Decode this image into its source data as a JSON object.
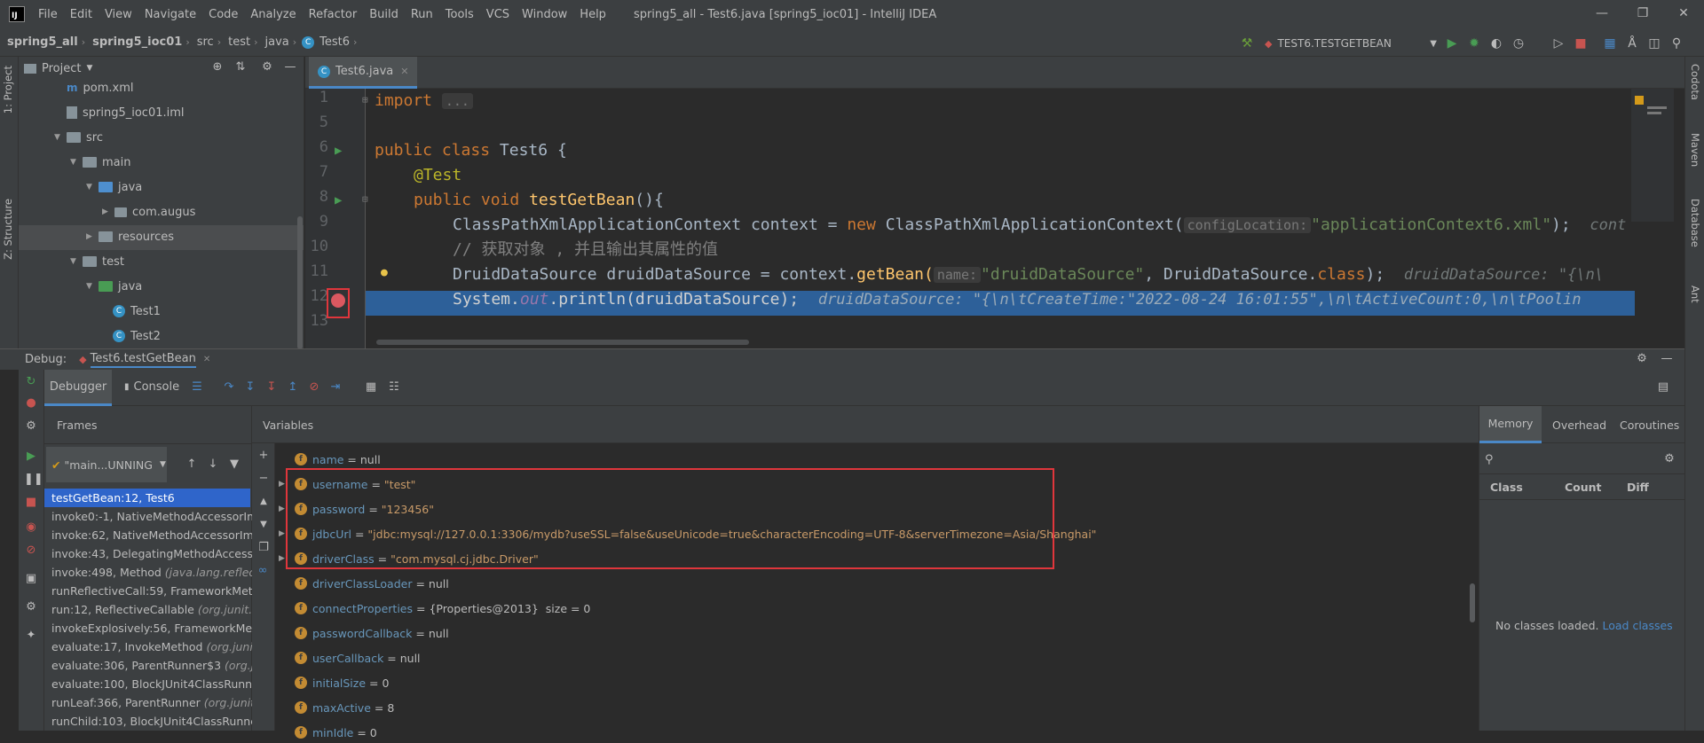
{
  "menubar": {
    "logo": "IJ",
    "items": [
      "File",
      "Edit",
      "View",
      "Navigate",
      "Code",
      "Analyze",
      "Refactor",
      "Build",
      "Run",
      "Tools",
      "VCS",
      "Window",
      "Help"
    ],
    "window_title": "spring5_all - Test6.java [spring5_ioc01] - IntelliJ IDEA"
  },
  "breadcrumbs": [
    "spring5_all",
    "spring5_ioc01",
    "src",
    "test",
    "java",
    "Test6"
  ],
  "run_config": "TEST6.TESTGETBEAN",
  "right_tools": [
    "Codota",
    "Maven",
    "Database",
    "Ant"
  ],
  "left_tools": [
    "1: Project",
    "Z: Structure"
  ],
  "project": {
    "title": "Project",
    "tree": [
      {
        "label": "pom.xml",
        "kind": "xml"
      },
      {
        "label": "spring5_ioc01.iml",
        "kind": "iml"
      },
      {
        "label": "src",
        "kind": "folder"
      },
      {
        "label": "main",
        "kind": "folder"
      },
      {
        "label": "java",
        "kind": "src-folder"
      },
      {
        "label": "com.augus",
        "kind": "package"
      },
      {
        "label": "resources",
        "kind": "res-folder"
      },
      {
        "label": "test",
        "kind": "folder"
      },
      {
        "label": "java",
        "kind": "test-folder"
      },
      {
        "label": "Test1",
        "kind": "class"
      },
      {
        "label": "Test2",
        "kind": "class"
      }
    ]
  },
  "editor": {
    "tab": "Test6.java",
    "line_numbers": [
      "1",
      "5",
      "6",
      "7",
      "8",
      "9",
      "10",
      "11",
      "12",
      "13"
    ],
    "code": {
      "import_kw": "import",
      "import_fold": "...",
      "l6_public": "public",
      "l6_class": "class",
      "l6_name": "Test6",
      "l6_brace": "{",
      "l7_anno": "@Test",
      "l8_public": "public",
      "l8_void": "void",
      "l8_fn": "testGetBean",
      "l8_rest": "(){",
      "l9_type": "ClassPathXmlApplicationContext context = ",
      "l9_new": "new",
      "l9_ctor": "ClassPathXmlApplicationContext(",
      "l9_hint": "configLocation:",
      "l9_str": "\"applicationContext6.xml\"",
      "l9_end": ");",
      "l9_inline": "cont",
      "l10_comment": "// 获取对象 , 并且输出其属性的值",
      "l11_a": "DruidDataSource druidDataSource = context.",
      "l11_fn": "getBean(",
      "l11_hint": "name:",
      "l11_str": "\"druidDataSource\"",
      "l11_b": ", DruidDataSource.",
      "l11_class": "class",
      "l11_end": ");",
      "l11_inline": "druidDataSource: \"{\\n\\",
      "l12_a": "System.",
      "l12_out": "out",
      "l12_b": ".println(druidDataSource);",
      "l12_inline": "druidDataSource: \"{\\n\\tCreateTime:\"2022-08-24 16:01:55\",\\n\\tActiveCount:0,\\n\\tPoolin"
    }
  },
  "debug": {
    "label": "Debug:",
    "session_tab": "Test6.testGetBean",
    "tabs": [
      "Debugger",
      "Console"
    ],
    "frames_title": "Frames",
    "variables_title": "Variables",
    "thread": "\"main...UNNING",
    "frames": [
      {
        "m": "testGetBean:12, Test6",
        "c": ""
      },
      {
        "m": "invoke0:-1, NativeMethodAccessorIm",
        "c": ""
      },
      {
        "m": "invoke:62, NativeMethodAccessorImp",
        "c": ""
      },
      {
        "m": "invoke:43, DelegatingMethodAccesso",
        "c": ""
      },
      {
        "m": "invoke:498, Method ",
        "c": "(java.lang.reflect"
      },
      {
        "m": "runReflectiveCall:59, FrameworkMethe",
        "c": ""
      },
      {
        "m": "run:12, ReflectiveCallable ",
        "c": "(org.junit.in"
      },
      {
        "m": "invokeExplosively:56, FrameworkMeth",
        "c": ""
      },
      {
        "m": "evaluate:17, InvokeMethod ",
        "c": "(org.junit."
      },
      {
        "m": "evaluate:306, ParentRunner$3 ",
        "c": "(org.jun"
      },
      {
        "m": "evaluate:100, BlockJUnit4ClassRunner",
        "c": ""
      },
      {
        "m": "runLeaf:366, ParentRunner ",
        "c": "(org.junit.r"
      },
      {
        "m": "runChild:103, BlockJUnit4ClassRunner",
        "c": ""
      },
      {
        "m": "runChild:63, BlockJUnit4ClassRunner",
        "c": ""
      }
    ],
    "variables": [
      {
        "name": "name",
        "eq": " = ",
        "val": "null",
        "type": "plain",
        "expand": false
      },
      {
        "name": "username",
        "eq": " = ",
        "val": "\"test\"",
        "type": "str",
        "expand": true
      },
      {
        "name": "password",
        "eq": " = ",
        "val": "\"123456\"",
        "type": "str",
        "expand": true
      },
      {
        "name": "jdbcUrl",
        "eq": " = ",
        "val": "\"jdbc:mysql://127.0.0.1:3306/mydb?useSSL=false&useUnicode=true&characterEncoding=UTF-8&serverTimezone=Asia/Shanghai\"",
        "type": "str",
        "expand": true
      },
      {
        "name": "driverClass",
        "eq": " = ",
        "val": "\"com.mysql.cj.jdbc.Driver\"",
        "type": "str",
        "expand": true
      },
      {
        "name": "driverClassLoader",
        "eq": " = ",
        "val": "null",
        "type": "plain",
        "expand": false
      },
      {
        "name": "connectProperties",
        "eq": " = ",
        "val": "{Properties@2013}  size = 0",
        "type": "plain",
        "expand": false
      },
      {
        "name": "passwordCallback",
        "eq": " = ",
        "val": "null",
        "type": "plain",
        "expand": false
      },
      {
        "name": "userCallback",
        "eq": " = ",
        "val": "null",
        "type": "plain",
        "expand": false
      },
      {
        "name": "initialSize",
        "eq": " = ",
        "val": "0",
        "type": "plain",
        "expand": false
      },
      {
        "name": "maxActive",
        "eq": " = ",
        "val": "8",
        "type": "plain",
        "expand": false
      },
      {
        "name": "minIdle",
        "eq": " = ",
        "val": "0",
        "type": "plain",
        "expand": false
      }
    ],
    "memory": {
      "tabs": [
        "Memory",
        "Overhead",
        "Coroutines"
      ],
      "cols": [
        "Class",
        "Count",
        "Diff"
      ],
      "empty": "No classes loaded.",
      "load": "Load classes"
    }
  },
  "colors": {
    "accent": "#4a88c7",
    "highlight_box": "#e0363c",
    "selection": "#2d6099"
  }
}
